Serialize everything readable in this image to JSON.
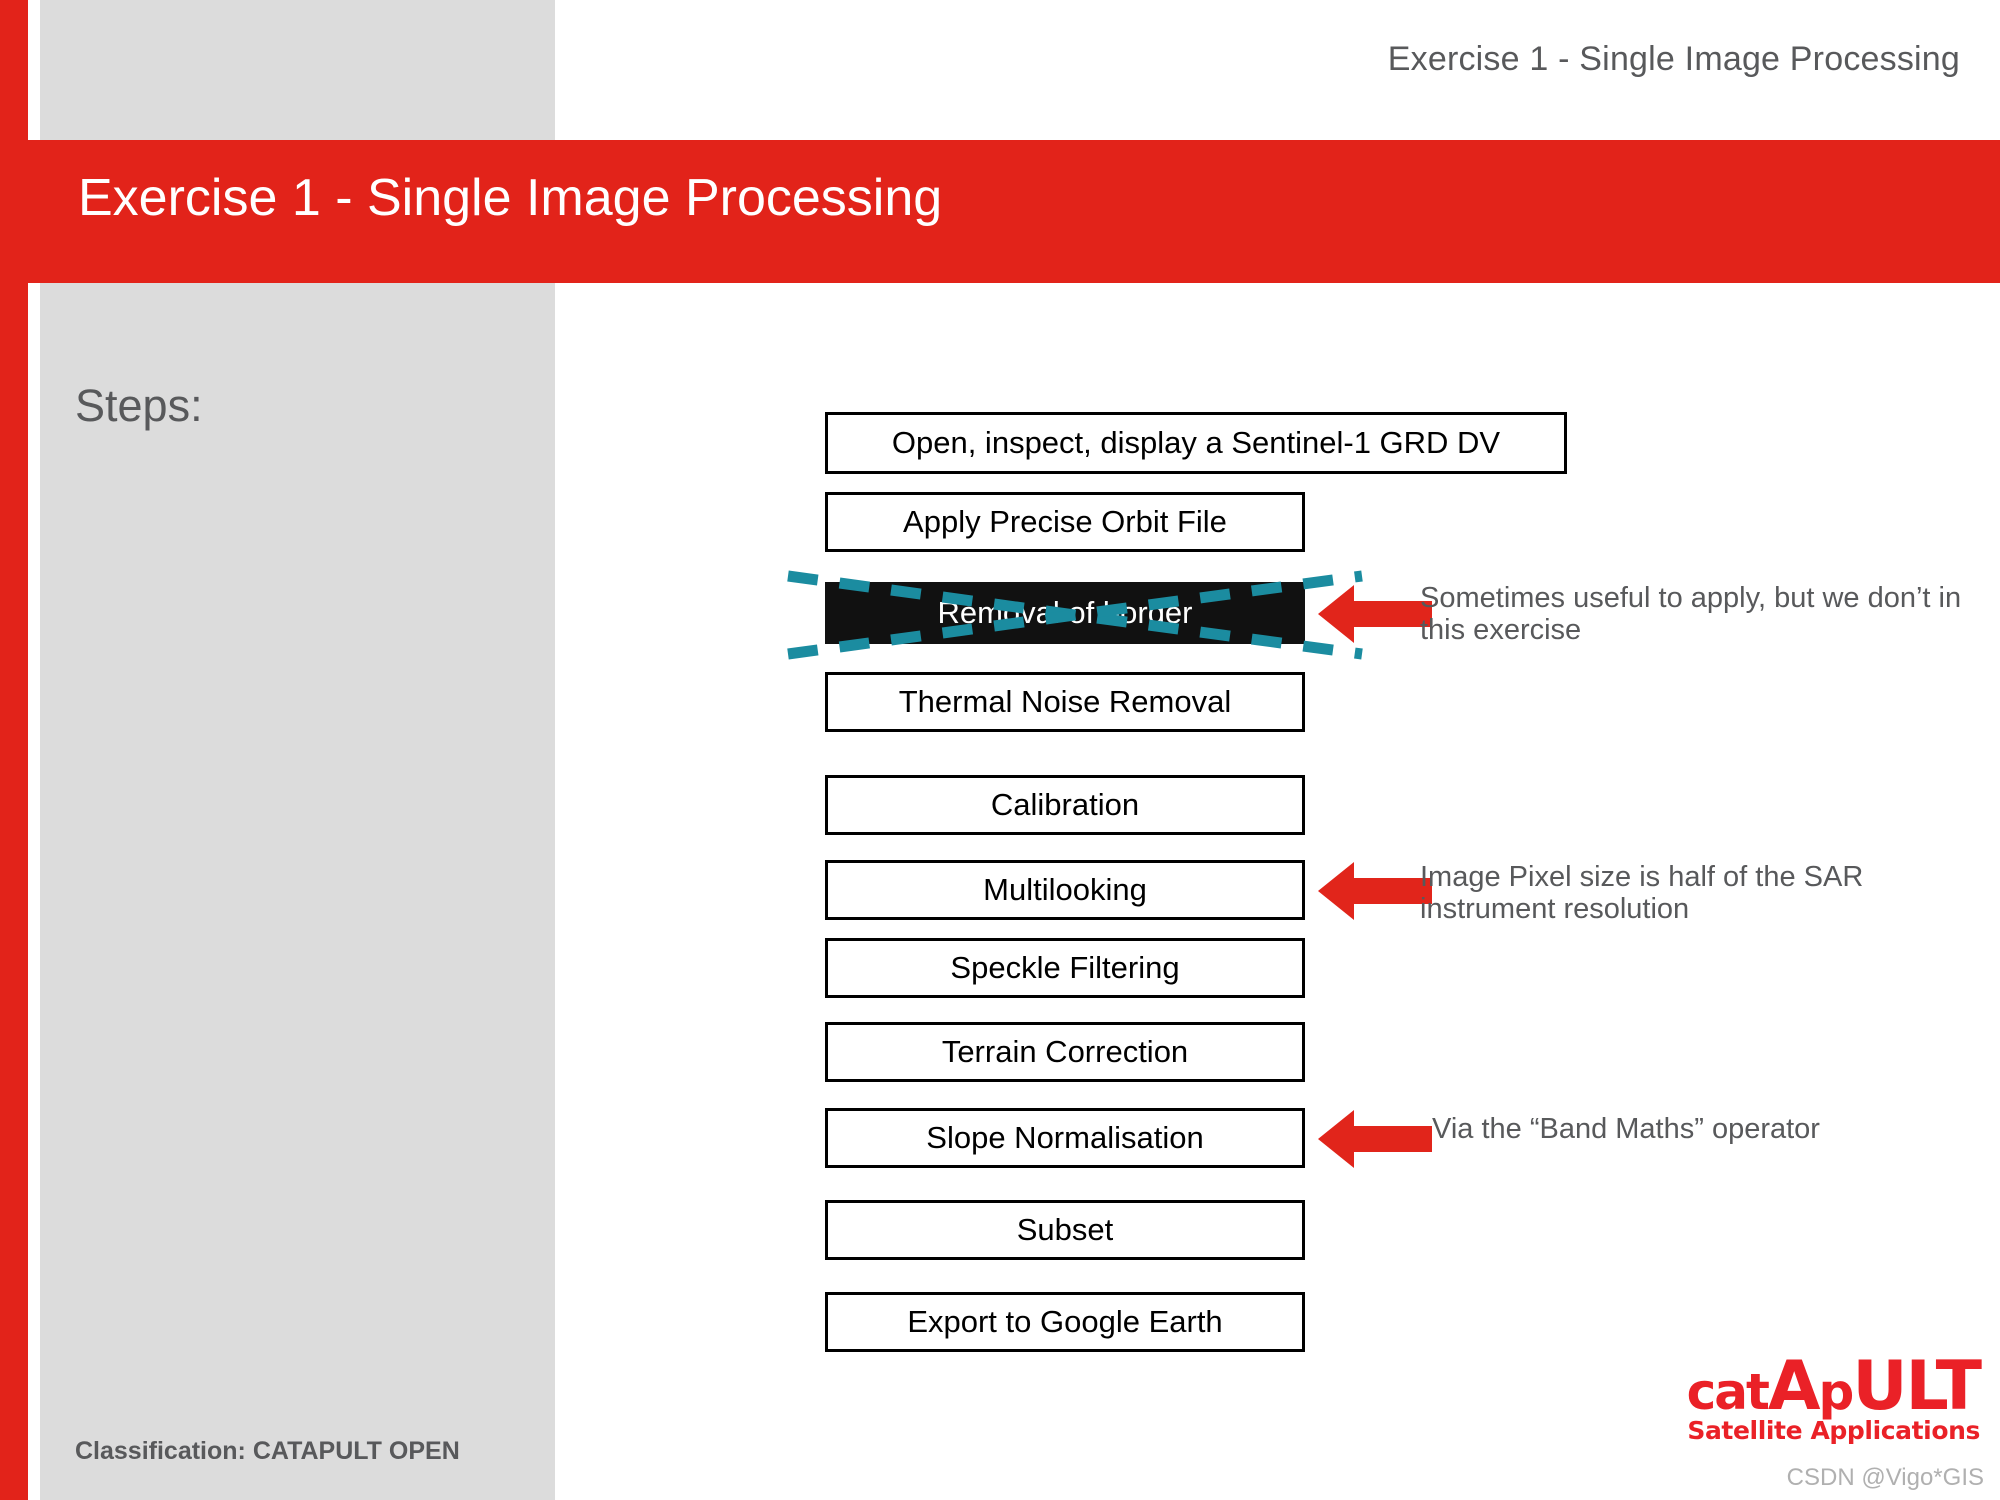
{
  "header": {
    "kicker": "Exercise 1 - Single Image Processing",
    "title": "Exercise 1 - Single Image Processing"
  },
  "content": {
    "steps_label": "Steps:"
  },
  "flow": {
    "boxes": [
      {
        "label": "Open, inspect, display a Sentinel-1 GRD DV",
        "struck": false
      },
      {
        "label": "Apply Precise Orbit File",
        "struck": false
      },
      {
        "label": "Removal of border",
        "struck": true
      },
      {
        "label": "Thermal Noise Removal",
        "struck": false
      },
      {
        "label": "Calibration",
        "struck": false
      },
      {
        "label": "Multilooking",
        "struck": false
      },
      {
        "label": "Speckle Filtering",
        "struck": false
      },
      {
        "label": "Terrain Correction",
        "struck": false
      },
      {
        "label": "Slope Normalisation",
        "struck": false
      },
      {
        "label": "Subset",
        "struck": false
      },
      {
        "label": "Export to Google Earth",
        "struck": false
      }
    ]
  },
  "callouts": [
    {
      "line1": "Sometimes useful to apply, but we don’t in",
      "line2": "this exercise"
    },
    {
      "line1": "Image Pixel size is half of the SAR",
      "line2": "instrument resolution"
    },
    {
      "line1": "Via the “Band Maths” operator",
      "line2": ""
    }
  ],
  "footer": {
    "classification": "Classification: CATAPULT OPEN",
    "watermark": "CSDN @Vigo*GIS"
  },
  "logo": {
    "part_lower": "cat",
    "part_a": "A",
    "part_p": "p",
    "part_upper": "ULT",
    "tagline": "Satellite Applications"
  },
  "colors": {
    "brand_red": "#E2231A",
    "logo_red": "#EA2127",
    "panel_gray": "#DCDCDC",
    "text_gray": "#58595B",
    "teal": "#1B8CA0",
    "struck_box": "#111111"
  }
}
